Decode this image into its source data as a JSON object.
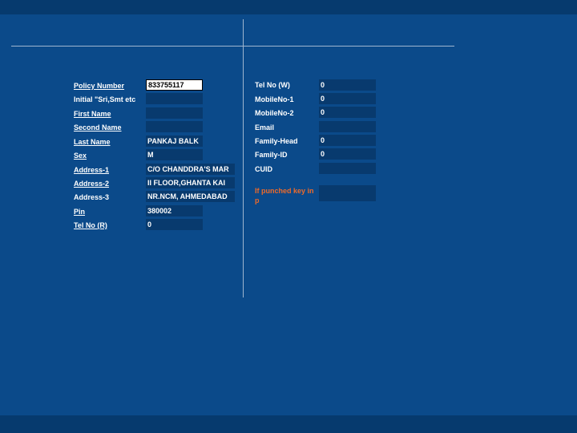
{
  "left": {
    "policy_number": {
      "label": "Policy Number",
      "value": "833755117"
    },
    "initial": {
      "label": "Initial \"Sri,Smt etc",
      "value": ""
    },
    "first_name": {
      "label": "First Name",
      "value": ""
    },
    "second_name": {
      "label": "Second Name",
      "value": ""
    },
    "last_name": {
      "label": "Last Name",
      "value": "PANKAJ BALK"
    },
    "sex": {
      "label": "Sex",
      "value": "M"
    },
    "address1": {
      "label": "Address-1",
      "value": "C/O CHANDDRA'S MAR"
    },
    "address2": {
      "label": "Address-2",
      "value": "II FLOOR,GHANTA KAI"
    },
    "address3": {
      "label": "Address-3",
      "value": "NR.NCM, AHMEDABAD"
    },
    "pin": {
      "label": "Pin",
      "value": "380002"
    },
    "tel_r": {
      "label": "Tel No (R)",
      "value": "0"
    }
  },
  "right": {
    "tel_w": {
      "label": "Tel No (W)",
      "value": "0"
    },
    "mobile1": {
      "label": "MobileNo-1",
      "value": "0"
    },
    "mobile2": {
      "label": "MobileNo-2",
      "value": "0"
    },
    "email": {
      "label": "Email",
      "value": ""
    },
    "family_head": {
      "label": "Family-Head",
      "value": "0"
    },
    "family_id": {
      "label": "Family-ID",
      "value": "0"
    },
    "cuid": {
      "label": "CUID",
      "value": ""
    },
    "punched_key": {
      "label": "If punched key in p",
      "value": ""
    }
  },
  "colors": {
    "background": "#0b4a8a",
    "field": "#083a6e",
    "accent": "#ee6a2a"
  }
}
